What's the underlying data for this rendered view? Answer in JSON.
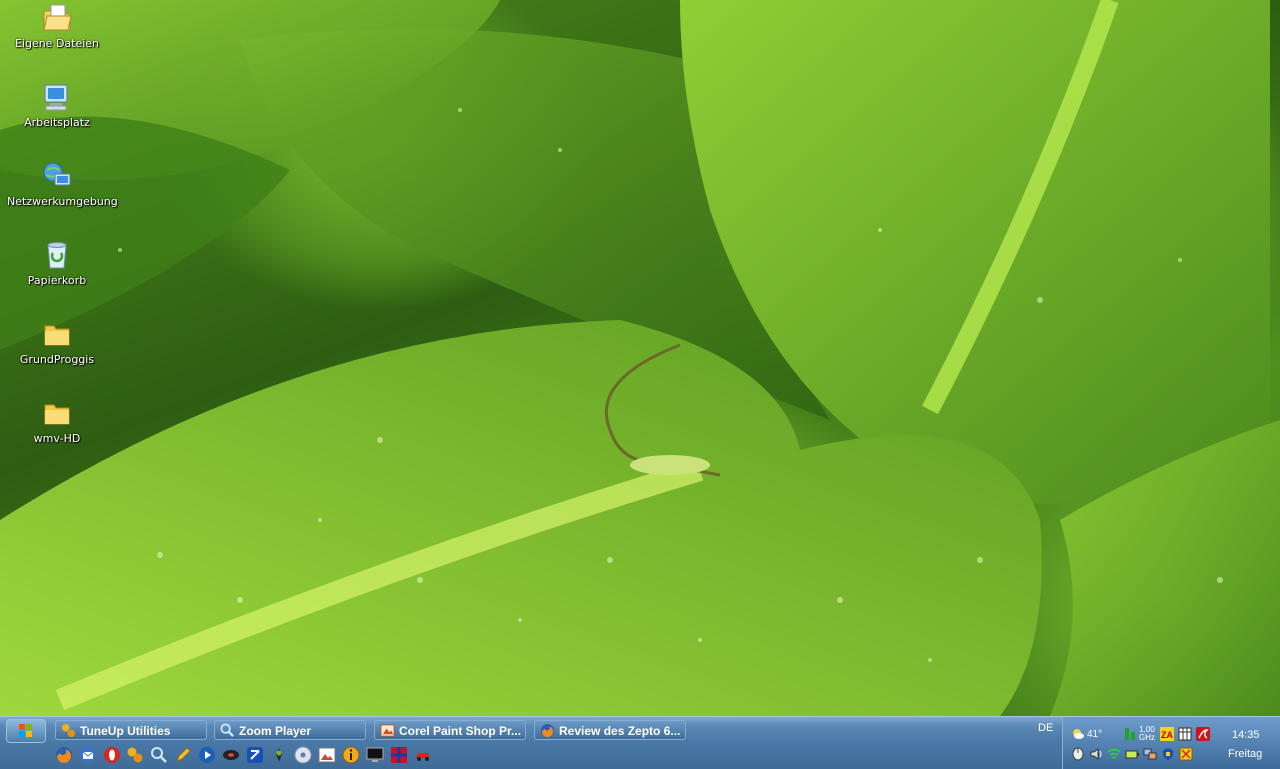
{
  "desktop": {
    "icons": [
      {
        "label": "Eigene Dateien",
        "icon": "my-documents-icon"
      },
      {
        "label": "Arbeitsplatz",
        "icon": "my-computer-icon"
      },
      {
        "label": "Netzwerkumgebung",
        "icon": "network-places-icon"
      },
      {
        "label": "Papierkorb",
        "icon": "recycle-bin-icon"
      },
      {
        "label": "GrundProggis",
        "icon": "folder-icon"
      },
      {
        "label": "wmv-HD",
        "icon": "folder-icon"
      }
    ]
  },
  "taskbar": {
    "tasks": [
      {
        "label": "TuneUp Utilities",
        "icon": "tuneup-icon"
      },
      {
        "label": "Zoom Player",
        "icon": "zoom-player-icon"
      },
      {
        "label": "Corel Paint Shop Pr...",
        "icon": "paint-shop-icon"
      },
      {
        "label": "Review des Zepto 6...",
        "icon": "firefox-icon"
      }
    ],
    "quick_launch": [
      "firefox-icon",
      "thunderbird-icon",
      "opera-icon",
      "tuneup-icon",
      "search-icon",
      "pencil-icon",
      "media-icon",
      "disc-icon",
      "dvd-icon",
      "game-icon",
      "cd-icon",
      "image-icon",
      "info-icon",
      "monitor-icon",
      "grid-icon",
      "car-icon"
    ],
    "language": "DE",
    "tray": {
      "temperature": "41°",
      "cpu_ghz_top": "1,00",
      "cpu_ghz_bottom": "GHz",
      "zonealarm": "ZA"
    },
    "clock": {
      "time": "14:35",
      "day": "Freitag"
    }
  },
  "colors": {
    "taskbar": "#4a78a6",
    "leaf_light": "#9fd83c",
    "leaf_dark": "#2e5e12"
  }
}
